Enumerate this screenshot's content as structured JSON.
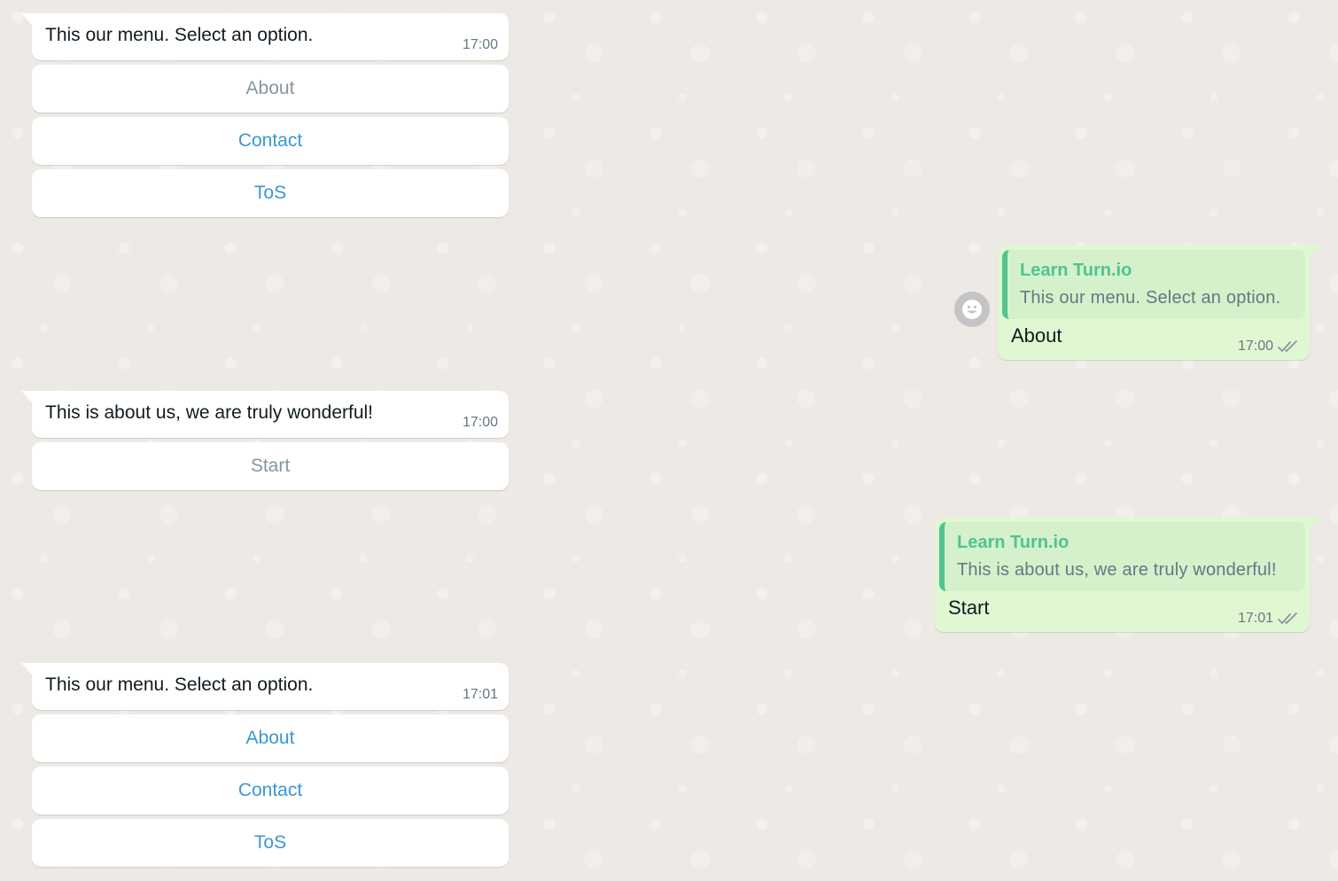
{
  "colors": {
    "background": "#ede9e4",
    "incoming_bubble": "#ffffff",
    "outgoing_bubble": "#e0f8d2",
    "quote_bg": "#d4f1cb",
    "quote_accent": "#4fc390",
    "button_active": "#3b97d3",
    "button_disabled": "#8696a0",
    "timestamp": "#667781"
  },
  "messages": [
    {
      "direction": "incoming",
      "text": "This our menu. Select an option.",
      "time": "17:00",
      "buttons": [
        {
          "label": "About",
          "state": "disabled"
        },
        {
          "label": "Contact",
          "state": "active"
        },
        {
          "label": "ToS",
          "state": "active"
        }
      ]
    },
    {
      "direction": "outgoing",
      "quote": {
        "author": "Learn Turn.io",
        "text": "This our menu. Select an option."
      },
      "text": "About",
      "time": "17:00",
      "status_icon": "double-check-icon",
      "avatar_icon": "smiley-face-icon"
    },
    {
      "direction": "incoming",
      "text": "This is about us, we are truly wonderful!",
      "time": "17:00",
      "buttons": [
        {
          "label": "Start",
          "state": "disabled"
        }
      ]
    },
    {
      "direction": "outgoing",
      "quote": {
        "author": "Learn Turn.io",
        "text": "This is about us, we are truly wonderful!"
      },
      "text": "Start",
      "time": "17:01",
      "status_icon": "double-check-icon"
    },
    {
      "direction": "incoming",
      "text": "This our menu. Select an option.",
      "time": "17:01",
      "buttons": [
        {
          "label": "About",
          "state": "active"
        },
        {
          "label": "Contact",
          "state": "active"
        },
        {
          "label": "ToS",
          "state": "active"
        }
      ]
    }
  ]
}
